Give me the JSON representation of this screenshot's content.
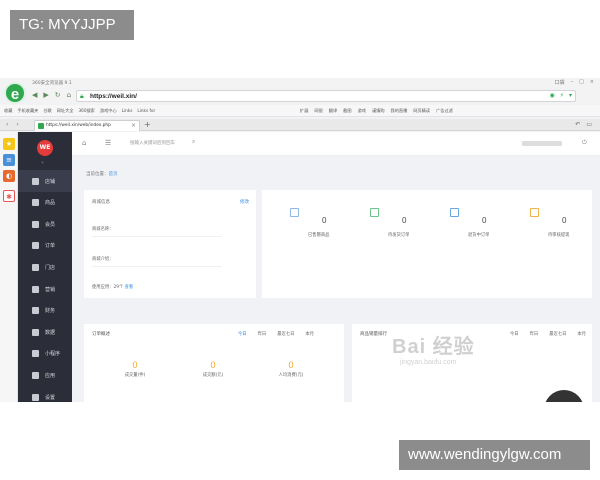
{
  "overlay": {
    "tag": "TG: MYYJJPP",
    "site": "www.wendingylgw.com"
  },
  "browser": {
    "title": "360安全浏览器 9.1",
    "window_controls": [
      "口袋",
      "–",
      "□",
      "×"
    ],
    "url": "https://weil.xin/",
    "bookmarks": [
      "收藏",
      "手机收藏夹",
      "谷歌",
      "网址大全",
      "360搜索",
      "游戏中心",
      "Links",
      "Links for"
    ],
    "toolbar_right": [
      "扩展",
      "网银",
      "翻译",
      "截图",
      "游戏",
      "谨慎购",
      "我的直播",
      "网页精读",
      "广告过滤"
    ],
    "tab": {
      "label": "https://weil.xin/web/index.php",
      "close": "×"
    },
    "tab_add": "+"
  },
  "icons": {
    "logo": "360-browser-logo",
    "back": "back-arrow-icon",
    "forward": "forward-arrow-icon",
    "refresh": "refresh-icon",
    "home": "home-icon",
    "lock": "lock-icon",
    "power": "power-icon",
    "search": "search-icon"
  },
  "app": {
    "logo_text": "WE",
    "header": {
      "search_placeholder": "搜输入关键词后到回车"
    },
    "sidebar": [
      {
        "label": "店铺",
        "icon": "store-icon"
      },
      {
        "label": "商品",
        "icon": "goods-icon"
      },
      {
        "label": "会员",
        "icon": "member-icon"
      },
      {
        "label": "订单",
        "icon": "order-icon"
      },
      {
        "label": "门店",
        "icon": "shop-icon"
      },
      {
        "label": "营销",
        "icon": "marketing-icon"
      },
      {
        "label": "财务",
        "icon": "finance-icon"
      },
      {
        "label": "数据",
        "icon": "data-icon"
      },
      {
        "label": "小程序",
        "icon": "miniapp-icon"
      },
      {
        "label": "应用",
        "icon": "apps-icon"
      },
      {
        "label": "设置",
        "icon": "settings-icon"
      }
    ],
    "breadcrumb": {
      "label": "当前位置：",
      "current": "首页"
    },
    "store_info": {
      "title": "商城信息",
      "edit": "修改",
      "name_label": "商城名称：",
      "intro_label": "商城介绍：",
      "apps_text": "使用应用：29个",
      "apps_link": "查看"
    },
    "stats": [
      {
        "value": "0",
        "label": "已售罄商品"
      },
      {
        "value": "0",
        "label": "待发货订单"
      },
      {
        "value": "0",
        "label": "退货中订单"
      },
      {
        "value": "0",
        "label": "待审核提现"
      }
    ],
    "orders": {
      "title": "订单概述",
      "tabs": [
        "今日",
        "昨日",
        "最近七日",
        "本月"
      ],
      "items": [
        {
          "value": "0",
          "label": "成交量(件)"
        },
        {
          "value": "0",
          "label": "成交额(元)"
        },
        {
          "value": "0",
          "label": "人均消费(元)"
        }
      ]
    },
    "ranking": {
      "title": "商品销量排行",
      "tabs": [
        "今日",
        "昨日",
        "最近七日",
        "本月"
      ]
    }
  },
  "watermark": {
    "main": "Bai 经验",
    "sub": "jingyan.baidu.com"
  }
}
